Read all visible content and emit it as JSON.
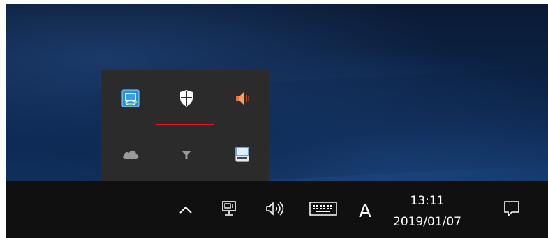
{
  "tray_overflow": {
    "icons": [
      {
        "icon": "intel-graphics-icon"
      },
      {
        "icon": "windows-security-shield-icon"
      },
      {
        "icon": "speaker-icon"
      },
      {
        "icon": "onedrive-cloud-icon"
      },
      {
        "icon": "filter-funnel-icon",
        "highlighted": true
      },
      {
        "icon": "removable-drive-icon"
      }
    ],
    "highlight_color": "#e8141c"
  },
  "taskbar": {
    "ime_indicator": "A",
    "clock": {
      "time": "13:11",
      "date": "2019/01/07"
    },
    "background_color": "#101010"
  }
}
